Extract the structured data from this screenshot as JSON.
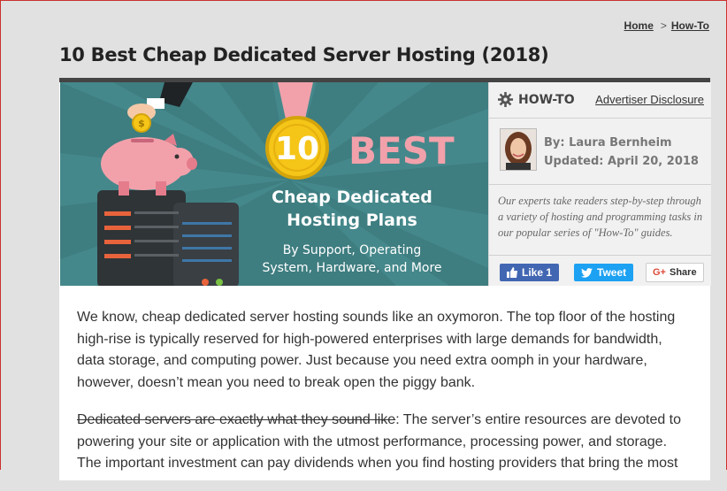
{
  "breadcrumb": {
    "home": "Home",
    "sep": ">",
    "current": "How-To"
  },
  "page": {
    "title": "10 Best Cheap Dedicated Server Hosting (2018)"
  },
  "hero": {
    "medal_number": "10",
    "best": "BEST",
    "headline_1": "Cheap Dedicated",
    "headline_2": "Hosting Plans",
    "sub_1": "By Support, Operating",
    "sub_2": "System, Hardware, and More",
    "coin_symbol": "$",
    "colors": {
      "teal": "#3e7d80",
      "pink": "#f2a1ab",
      "gold": "#f5c518",
      "dark": "#2f3437"
    }
  },
  "sidebar": {
    "howto_label": "HOW-TO",
    "disclosure": "Advertiser Disclosure",
    "author_line": "By: Laura Bernheim",
    "updated_line": "Updated: April 20, 2018",
    "blurb": "Our experts take readers step-by-step through a variety of hosting and programming tasks in our popular series of \"How-To\" guides.",
    "share": {
      "like": "Like 1",
      "tweet": "Tweet",
      "gplus": "G+",
      "share": "Share"
    }
  },
  "article": {
    "p1": "We know, cheap dedicated server hosting sounds like an oxymoron. The top floor of the hosting high-rise is typically reserved for high-powered enterprises with large demands for bandwidth, data storage, and computing power. Just because you need extra oomph in your hardware, however, doesn’t mean you need to break open the piggy bank.",
    "p2_strike": "Dedicated servers are exactly what they sound like",
    "p2_rest": ": The server’s entire resources are devoted to powering your site or application with the utmost performance, processing power, and storage. The important investment can pay dividends when you find hosting providers that bring the most"
  }
}
